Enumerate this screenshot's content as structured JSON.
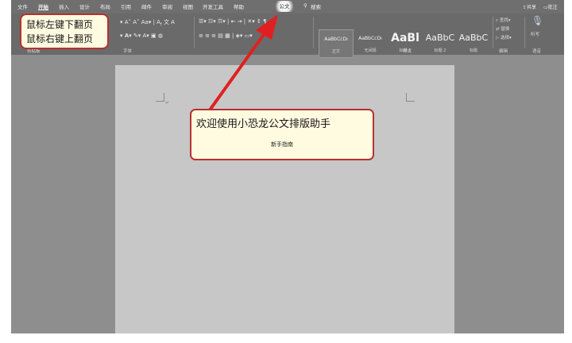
{
  "menu": {
    "tabs": [
      "文件",
      "开始",
      "插入",
      "设计",
      "布局",
      "引用",
      "邮件",
      "审阅",
      "视图",
      "开发工具",
      "帮助",
      "公文",
      "搜索"
    ],
    "active": "开始",
    "highlighted": "公文",
    "share": "共享",
    "comment": "批注"
  },
  "ribbon": {
    "font_group_label": "字体",
    "clipboard_label": "剪贴板",
    "styles_label": "样式",
    "edit_label": "编辑",
    "voice_label": "语音",
    "styles": [
      {
        "preview": "AaBbCcDı",
        "name": "正文"
      },
      {
        "preview": "AaBbCcDı",
        "name": "无间隔"
      },
      {
        "preview": "AaBl",
        "name": "标题 1"
      },
      {
        "preview": "AaBbC",
        "name": "标题 2"
      },
      {
        "preview": "AaBbC",
        "name": "标题"
      }
    ],
    "find": "查找",
    "replace": "替换",
    "select": "选择",
    "dictate": "听写"
  },
  "hint": {
    "line1": "鼠标左键下翻页",
    "line2": "鼠标右键上翻页"
  },
  "welcome": {
    "title": "欢迎使用小恐龙公文排版助手",
    "subtitle": "新手指南"
  },
  "colors": {
    "accent_border": "#b83030",
    "callout_fill": "#fffbe0",
    "arrow": "#e02020"
  }
}
